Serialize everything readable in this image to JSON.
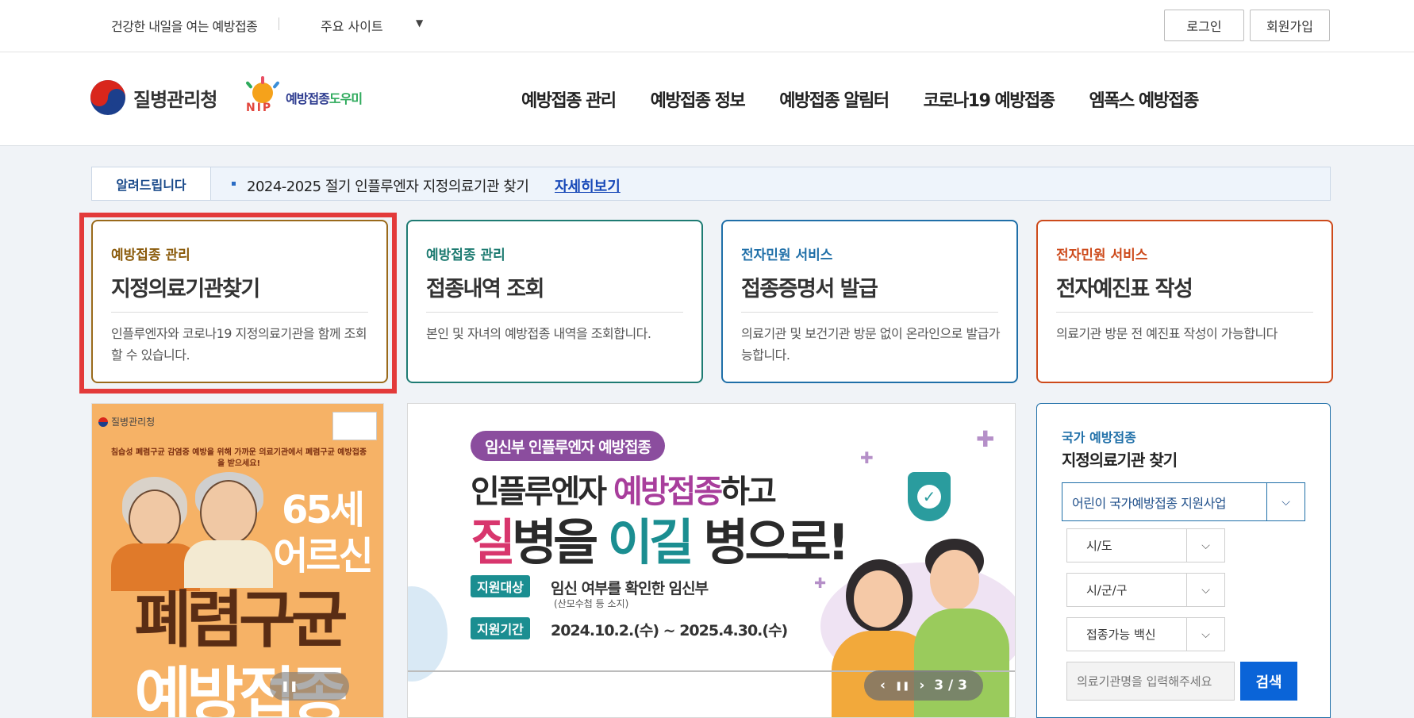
{
  "topbar": {
    "slogan": "건강한 내일을 여는 예방접종",
    "sites_label": "주요 사이트",
    "sites_arrow": "▼",
    "login_label": "로그인",
    "join_label": "회원가입"
  },
  "header": {
    "kdca_name": "질병관리청",
    "nip_mark": "NIP",
    "nip_name_main": "예방접종",
    "nip_name_accent": "도우미",
    "nav": [
      "예방접종 관리",
      "예방접종 정보",
      "예방접종 알림터",
      "코로나19 예방접종",
      "엠폭스 예방접종"
    ]
  },
  "notice": {
    "label": "알려드립니다",
    "text": "2024-2025 절기 인플루엔자 지정의료기관 찾기",
    "more": "자세히보기"
  },
  "cards": [
    {
      "category": "예방접종 관리",
      "title": "지정의료기관찾기",
      "desc": "인플루엔자와 코로나19 지정의료기관을 함께 조회할 수 있습니다."
    },
    {
      "category": "예방접종 관리",
      "title": "접종내역 조회",
      "desc": "본인 및 자녀의 예방접종 내역을 조회합니다."
    },
    {
      "category": "전자민원 서비스",
      "title": "접종증명서 발급",
      "desc": "의료기관 및 보건기관 방문 없이 온라인으로 발급가능합니다."
    },
    {
      "category": "전자민원 서비스",
      "title": "전자예진표 작성",
      "desc": "의료기관 방문 전 예진표 작성이 가능합니다"
    }
  ],
  "poster": {
    "brand": "질병관리청",
    "sub": "침습성 폐렴구균 감염증 예방을 위해 가까운 의료기관에서 폐렴구균 예방접종을 받으세요!",
    "age": "65세 어르신",
    "disease": "폐렴구균",
    "vaccination": "예방접종",
    "pause_icon": "pause-icon"
  },
  "slide": {
    "pill": "임신부 인플루엔자 예방접종",
    "h1_pre": "인플루엔자 ",
    "h1_accent": "예방접종",
    "h1_post": "하고",
    "h2_a": "질",
    "h2_b": "병을 ",
    "h2_c": "이길",
    "h2_d": " 병으로!",
    "tag1": "지원대상",
    "info1": "임신 여부를 확인한 임신부",
    "note1": "(산모수첩 등 소지)",
    "tag2": "지원기간",
    "info2": "2024.10.2.(수) ~ 2025.4.30.(수)",
    "counter": "3 / 3",
    "prev_icon": "‹",
    "pause_icon": "❚❚",
    "next_icon": "›"
  },
  "search": {
    "sub": "국가 예방접종",
    "head": "지정의료기관 찾기",
    "program": "어린이 국가예방접종 지원사업",
    "sido": "시/도",
    "sigungu": "시/군/구",
    "vaccine": "접종가능 백신",
    "input_placeholder": "의료기관명을 입력해주세요",
    "button": "검색",
    "arrow": "⌵"
  },
  "colors": {
    "card1": "#9a6a1b",
    "card2": "#1e7b73",
    "card3": "#1f6fa8",
    "card4": "#cd4a1b",
    "highlight": "#e33a3a",
    "search_button": "#0a64d8"
  }
}
